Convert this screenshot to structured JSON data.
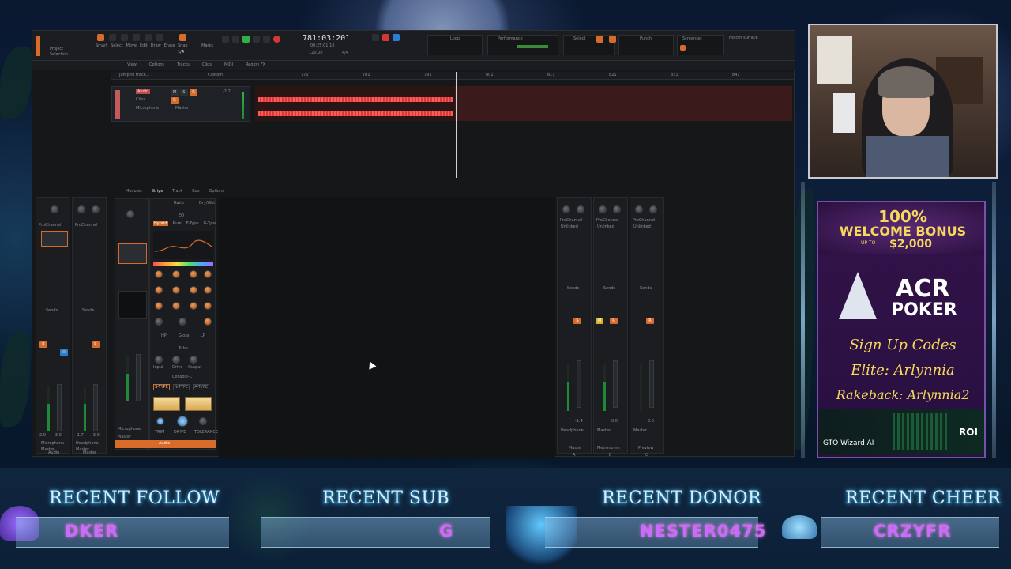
{
  "daw": {
    "toolbar": {
      "project_label": "Project",
      "selection_label": "Selection",
      "tools": [
        "Smart",
        "Select",
        "Move",
        "Edit",
        "Draw",
        "Erase"
      ],
      "snap_label": "Snap",
      "snap_value": "1/4",
      "marks_label": "Marks",
      "counter": "781:03:201",
      "counter_sub": "00:25:01:16",
      "tempo": "120.00",
      "meter": "4/4",
      "loop_label": "Loop",
      "performance_label": "Performance",
      "select_label": "Select",
      "punch_label": "Punch",
      "screenset_label": "Screenset",
      "screenset_nums": [
        "1",
        "2",
        "3",
        "4",
        "5",
        "6",
        "7",
        "8",
        "9",
        "10"
      ],
      "surface_label": "No ctrl surface"
    },
    "menubar": [
      "View",
      "Options",
      "Tracks",
      "Clips",
      "MIDI",
      "Region FX"
    ],
    "track_view": {
      "jump_label": "Jump to track...",
      "custom_label": "Custom",
      "ruler_marks": [
        "771",
        "781",
        "791",
        "801",
        "811",
        "821",
        "831",
        "841",
        "851"
      ],
      "track_name": "Audio",
      "track_sub": "Clips",
      "input": "Microphone",
      "output": "Master",
      "volume": "-2.2"
    },
    "inspector": {
      "tabs": [
        "Modules",
        "Strips",
        "Track",
        "Bus",
        "Options"
      ],
      "ratio_label": "Ratio",
      "dry_wet_label": "Dry/Wet",
      "eq_modes": [
        "Hybrid",
        "Pure",
        "E-Type",
        "G-Type"
      ],
      "eq_label": "EQ",
      "hp_label": "HP",
      "gloss_label": "Gloss",
      "lp_label": "LP",
      "tube_label": "Tube",
      "input_label": "Input",
      "drive_label": "Drive",
      "output_label": "Output",
      "console_label": "Console-C",
      "console_modes": [
        "S-TYPE",
        "N-TYPE",
        "A-TYPE"
      ],
      "trim_label": "TRIM",
      "drive2_label": "DRIVE",
      "tolerance_label": "TOLERANCE",
      "track_input": "Microphone",
      "track_output": "Master",
      "footer_name": "Audio"
    },
    "left_strips": [
      {
        "name": "Audio",
        "pro": "ProChannel",
        "sends": "Sends",
        "io_in": "Microphone",
        "io_out": "Master",
        "vol": "2.0",
        "pan": "-3.0"
      },
      {
        "name": "Master",
        "pro": "ProChannel",
        "sends": "Sends",
        "io_in": "Headphone",
        "io_out": "Master",
        "vol": "-1.7",
        "pan": "-3.0"
      }
    ],
    "right_strips": [
      {
        "name": "Master",
        "pro": "ProChannel",
        "sends": "Sends",
        "io": "Headphone",
        "letter": "A",
        "vol": "-1.4"
      },
      {
        "name": "Metronome",
        "pro": "ProChannel",
        "sends": "Sends",
        "io": "Master",
        "letter": "B",
        "vol": "0.0"
      },
      {
        "name": "Preview",
        "pro": "ProChannel",
        "sends": "Sends",
        "io": "Master",
        "letter": "C",
        "vol": "0.0"
      }
    ],
    "unlinked": "Unlinked"
  },
  "ad": {
    "bonus_line1": "100%",
    "bonus_line2": "WELCOME BONUS",
    "bonus_up": "UP TO",
    "bonus_amount": "$2,000",
    "brand1": "ACR",
    "brand2": "POKER",
    "codes_title": "Sign Up Codes",
    "elite": "Elite: Arlynnia",
    "rakeback": "Rakeback: Arlynnia2",
    "gto_label": "GTO Wizard AI",
    "roi_label": "ROI"
  },
  "overlay": {
    "recent_follow_title": "RECENT FOLLOW",
    "recent_follow_value": "DKER",
    "recent_sub_title": "RECENT SUB",
    "recent_sub_value": "G",
    "recent_donor_title": "RECENT DONOR",
    "recent_donor_value": "NESTER0475",
    "recent_cheer_title": "RECENT CHEER",
    "recent_cheer_value": "CRZYFR"
  },
  "colors": {
    "accent": "#d76b2a",
    "record": "#d63636",
    "play": "#2fb04a",
    "waveform": "#ff5a5a",
    "overlay_value": "#c76cff"
  }
}
